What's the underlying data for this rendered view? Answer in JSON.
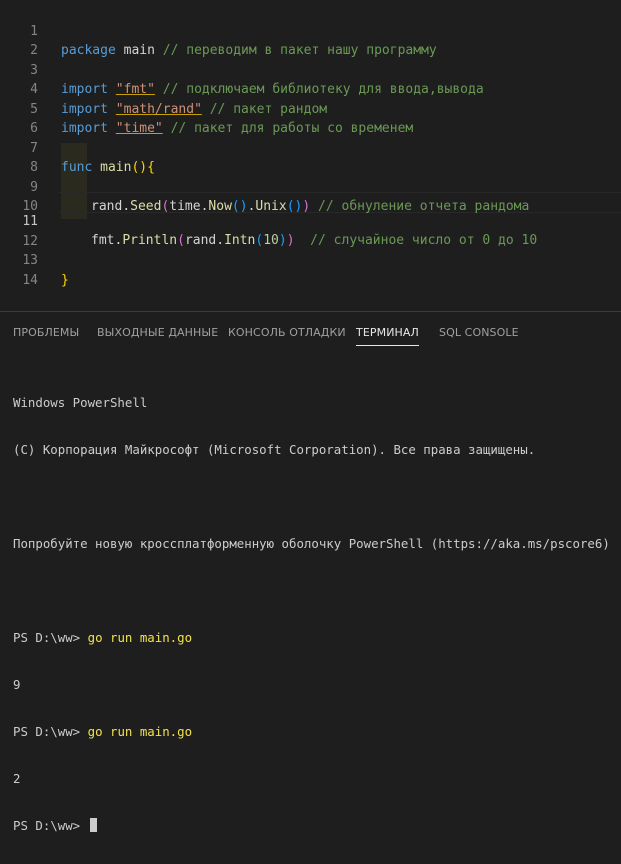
{
  "editor": {
    "lines": [
      {
        "n": "1",
        "t": {
          "kw": "package",
          "sp": " ",
          "id": "main",
          "cm": " // переводим в пакет нашу программу"
        }
      },
      {
        "n": "2"
      },
      {
        "n": "3",
        "t": {
          "kw": "import",
          "sp": " ",
          "str": "\"fmt\"",
          "cm": " // подключаем библиотеку для ввода,вывода"
        }
      },
      {
        "n": "4",
        "t": {
          "kw": "import",
          "sp": " ",
          "str": "\"math/rand\"",
          "cm": " // пакет рандом"
        }
      },
      {
        "n": "5",
        "t": {
          "kw": "import",
          "sp": " ",
          "str": "\"time\"",
          "cm": " // пакет для работы со временем"
        }
      },
      {
        "n": "6"
      },
      {
        "n": "7",
        "t": {
          "kw": "func",
          "sp": " ",
          "fn": "main",
          "br": "(){"
        }
      },
      {
        "n": "8"
      },
      {
        "n": "9"
      },
      {
        "n": "10"
      },
      {
        "n": "11"
      },
      {
        "n": "12"
      },
      {
        "n": "13",
        "t": {
          "br": "}"
        }
      },
      {
        "n": "14"
      }
    ],
    "line9": {
      "a": "rand",
      "b": ".",
      "c": "Seed",
      "d": "(",
      "e": "time",
      "f": ".",
      "g": "Now",
      "h": "()",
      "i": ".",
      "j": "Unix",
      "k": "()",
      "l": ")",
      "cm": " // обнуление отчета рандома"
    },
    "line11": {
      "a": "fmt",
      "b": ".",
      "c": "Println",
      "d": "(",
      "e": "rand",
      "f": ".",
      "g": "Intn",
      "h": "(",
      "num": "10",
      "i": ")",
      "j": ")",
      "cm": "  // случайное число от 0 до 10"
    }
  },
  "panel": {
    "tabs": [
      {
        "label": "ПРОБЛЕМЫ",
        "active": false
      },
      {
        "label": "ВЫХОДНЫЕ ДАННЫЕ",
        "active": false
      },
      {
        "label": "КОНСОЛЬ ОТЛАДКИ",
        "active": false
      },
      {
        "label": "ТЕРМИНАЛ",
        "active": true
      },
      {
        "label": "SQL CONSOLE",
        "active": false
      }
    ],
    "terminal": {
      "l1": "Windows PowerShell",
      "l2": "(C) Корпорация Майкрософт (Microsoft Corporation). Все права защищены.",
      "l3": "Попробуйте новую кроссплатформенную оболочку PowerShell (https://aka.ms/pscore6)",
      "prompt": "PS D:\\ww> ",
      "cmd": "go run main.go",
      "out1": "9",
      "out2": "2"
    }
  },
  "colors": {
    "accent": "#569cd6",
    "comment": "#6a9955",
    "string": "#ce9178",
    "function": "#dcdcaa",
    "command": "#f2e34c"
  }
}
